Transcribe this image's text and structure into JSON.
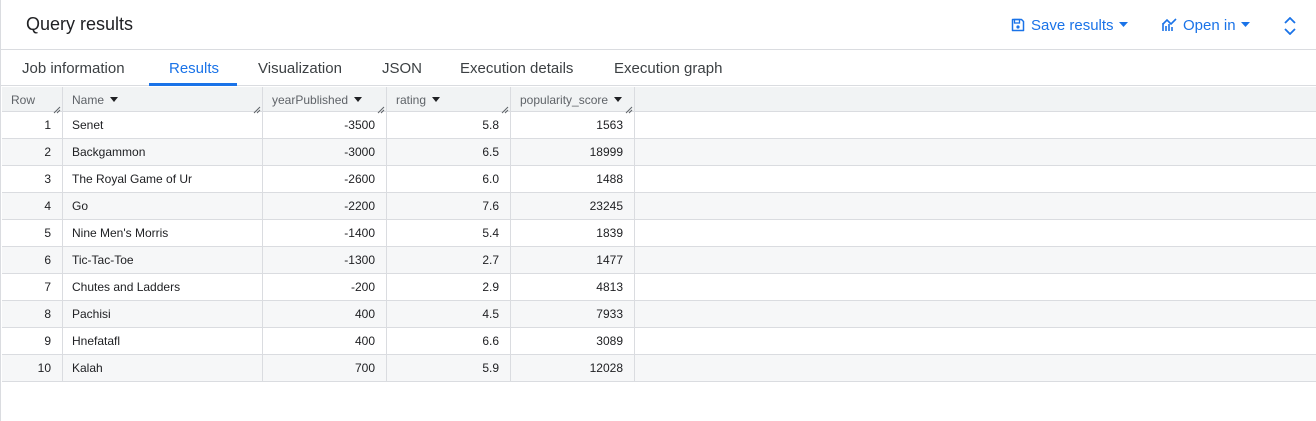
{
  "header": {
    "title": "Query results",
    "save_label": "Save results",
    "open_label": "Open in"
  },
  "tabs": [
    {
      "label": "Job information"
    },
    {
      "label": "Results",
      "active": true
    },
    {
      "label": "Visualization"
    },
    {
      "label": "JSON"
    },
    {
      "label": "Execution details"
    },
    {
      "label": "Execution graph"
    }
  ],
  "table": {
    "columns": [
      "Row",
      "Name",
      "yearPublished",
      "rating",
      "popularity_score"
    ],
    "rows": [
      {
        "row": "1",
        "name": "Senet",
        "year": "-3500",
        "rating": "5.8",
        "popularity": "1563"
      },
      {
        "row": "2",
        "name": "Backgammon",
        "year": "-3000",
        "rating": "6.5",
        "popularity": "18999"
      },
      {
        "row": "3",
        "name": "The Royal Game of Ur",
        "year": "-2600",
        "rating": "6.0",
        "popularity": "1488"
      },
      {
        "row": "4",
        "name": "Go",
        "year": "-2200",
        "rating": "7.6",
        "popularity": "23245"
      },
      {
        "row": "5",
        "name": "Nine Men's Morris",
        "year": "-1400",
        "rating": "5.4",
        "popularity": "1839"
      },
      {
        "row": "6",
        "name": "Tic-Tac-Toe",
        "year": "-1300",
        "rating": "2.7",
        "popularity": "1477"
      },
      {
        "row": "7",
        "name": "Chutes and Ladders",
        "year": "-200",
        "rating": "2.9",
        "popularity": "4813"
      },
      {
        "row": "8",
        "name": "Pachisi",
        "year": "400",
        "rating": "4.5",
        "popularity": "7933"
      },
      {
        "row": "9",
        "name": "Hnefatafl",
        "year": "400",
        "rating": "6.6",
        "popularity": "3089"
      },
      {
        "row": "10",
        "name": "Kalah",
        "year": "700",
        "rating": "5.9",
        "popularity": "12028"
      }
    ]
  },
  "colors": {
    "accent": "#1a73e8",
    "border": "#dadce0",
    "header_bg": "#f1f3f4",
    "alt_row_bg": "#f6f7f8"
  },
  "icons": {
    "save": "save-icon",
    "open": "chart-icon",
    "expand": "unfold-icon"
  }
}
